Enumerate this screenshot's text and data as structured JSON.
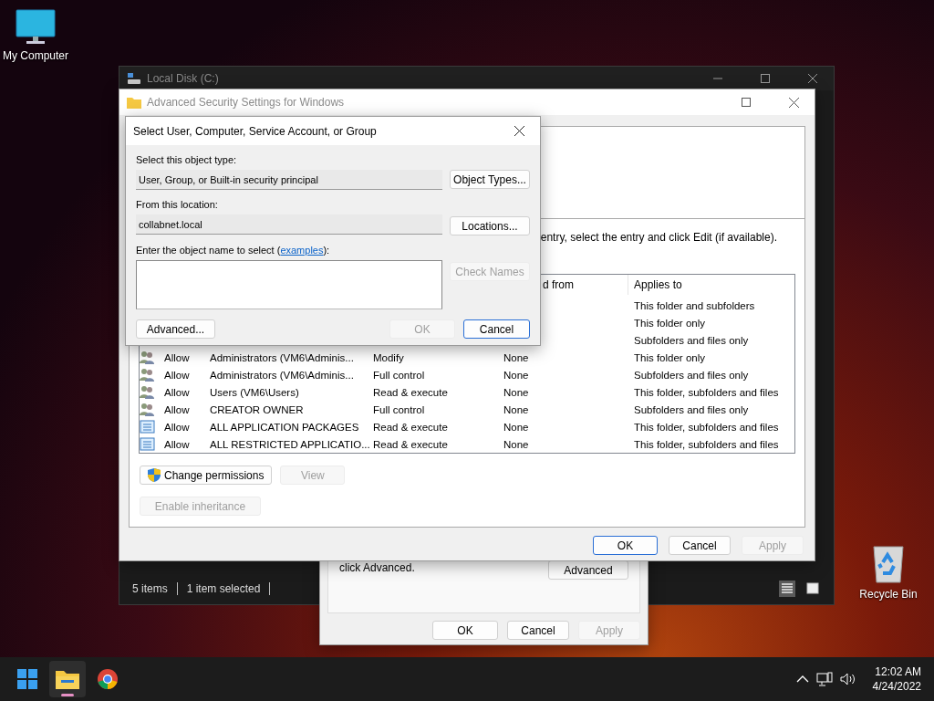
{
  "desktop_icons": [
    {
      "kind": "computer",
      "label": "My Computer"
    },
    {
      "kind": "recycle",
      "label": "Recycle Bin"
    }
  ],
  "explorer": {
    "title": "Local Disk (C:)",
    "status": [
      "5 items",
      "1 item selected"
    ],
    "view_buttons": [
      {
        "kind": "details",
        "selected": true
      },
      {
        "kind": "preview",
        "selected": false
      }
    ]
  },
  "properties": {
    "text": "click Advanced.",
    "advanced_button": "Advanced",
    "buttons": [
      {
        "label": "OK",
        "disabled": false
      },
      {
        "label": "Cancel",
        "disabled": false
      },
      {
        "label": "Apply",
        "disabled": true
      }
    ]
  },
  "advanced_security": {
    "title": "Advanced Security Settings for Windows",
    "hint": "entry, select the entry and click Edit (if available).",
    "columns": [
      "d from",
      "Applies to"
    ],
    "rows": [
      {
        "applies_to": "This folder and subfolders"
      },
      {
        "applies_to": "This folder only"
      },
      {
        "applies_to": "Subfolders and files only"
      },
      {
        "kind": "group",
        "type": "Allow",
        "principal": "Administrators (VM6\\Adminis...",
        "access": "Modify",
        "inherited": "None",
        "applies_to": "This folder only"
      },
      {
        "kind": "group",
        "type": "Allow",
        "principal": "Administrators (VM6\\Adminis...",
        "access": "Full control",
        "inherited": "None",
        "applies_to": "Subfolders and files only"
      },
      {
        "kind": "group",
        "type": "Allow",
        "principal": "Users (VM6\\Users)",
        "access": "Read & execute",
        "inherited": "None",
        "applies_to": "This folder, subfolders and files"
      },
      {
        "kind": "group",
        "type": "Allow",
        "principal": "CREATOR OWNER",
        "access": "Full control",
        "inherited": "None",
        "applies_to": "Subfolders and files only"
      },
      {
        "kind": "package",
        "type": "Allow",
        "principal": "ALL APPLICATION PACKAGES",
        "access": "Read & execute",
        "inherited": "None",
        "applies_to": "This folder, subfolders and files"
      },
      {
        "kind": "package",
        "type": "Allow",
        "principal": "ALL RESTRICTED APPLICATIO...",
        "access": "Read & execute",
        "inherited": "None",
        "applies_to": "This folder, subfolders and files"
      }
    ],
    "change_permissions": "Change permissions",
    "view": {
      "label": "View",
      "disabled": true
    },
    "enable_inheritance": {
      "label": "Enable inheritance",
      "disabled": true
    },
    "buttons": [
      {
        "label": "OK",
        "disabled": false,
        "focused": true
      },
      {
        "label": "Cancel",
        "disabled": false,
        "focused": false
      },
      {
        "label": "Apply",
        "disabled": true,
        "focused": false
      }
    ]
  },
  "select_dialog": {
    "title": "Select User, Computer, Service Account, or Group",
    "object_type_label": "Select this object type:",
    "object_type": "User, Group, or Built-in security principal",
    "object_types_button": "Object Types...",
    "location_label": "From this location:",
    "location": "collabnet.local",
    "locations_button": "Locations...",
    "name_label": "Enter the object name to select (",
    "examples_link": "examples",
    "name_label_end": "):",
    "check_names": {
      "label": "Check Names",
      "disabled": true
    },
    "advanced_button": "Advanced...",
    "buttons": [
      {
        "label": "OK",
        "disabled": true,
        "focused": false
      },
      {
        "label": "Cancel",
        "disabled": false,
        "focused": true
      }
    ]
  },
  "taskbar": {
    "apps": [
      {
        "kind": "explorer",
        "selected": true
      },
      {
        "kind": "chrome",
        "selected": false
      }
    ],
    "time": "12:02 AM",
    "date": "4/24/2022"
  }
}
